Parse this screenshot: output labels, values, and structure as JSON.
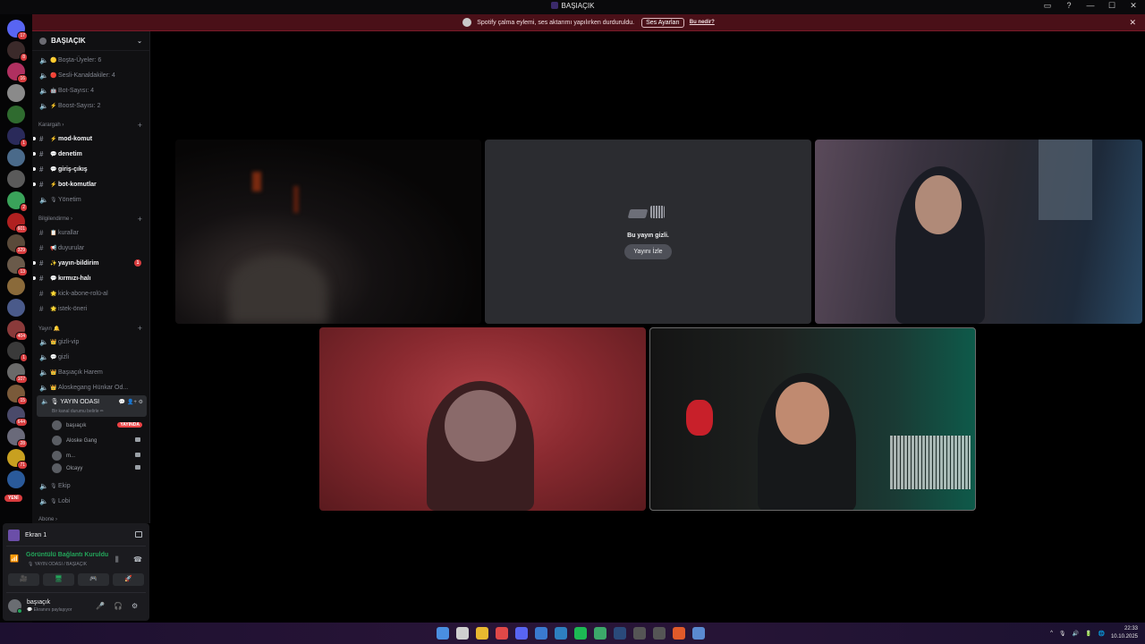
{
  "window": {
    "title": "BAŞIAÇIK",
    "controls": [
      "▭",
      "?",
      "—",
      "☐",
      "✕"
    ]
  },
  "banner": {
    "text": "Spotify çalma eylemi, ses aktarımı yapılırken durduruldu.",
    "button": "Ses Ayarları",
    "link": "Bu nedir?",
    "close": "✕"
  },
  "guilds": [
    {
      "badge": "17",
      "color": "#5865f2"
    },
    {
      "badge": "8",
      "color": "#3b2a2a"
    },
    {
      "badge": "16",
      "color": "#b03060"
    },
    {
      "badge": "",
      "color": "#8a8a8a"
    },
    {
      "badge": "",
      "color": "#2f6b2f"
    },
    {
      "badge": "1",
      "color": "#2a2a5a"
    },
    {
      "badge": "",
      "color": "#4a6a8a"
    },
    {
      "badge": "",
      "color": "#5a5a5a"
    },
    {
      "badge": "2",
      "color": "#3aa35a"
    },
    {
      "badge": "601",
      "color": "#b02020"
    },
    {
      "badge": "329",
      "color": "#5a4a3a"
    },
    {
      "badge": "13",
      "color": "#6a5a4a"
    },
    {
      "badge": "",
      "color": "#8a6a3a"
    },
    {
      "badge": "",
      "color": "#4a5a8a"
    },
    {
      "badge": "404",
      "color": "#8a3a3a"
    },
    {
      "badge": "1",
      "color": "#3a3a3a"
    },
    {
      "badge": "107",
      "color": "#6a6a6a"
    },
    {
      "badge": "15",
      "color": "#7a5a3a"
    },
    {
      "badge": "644",
      "color": "#4a4a6a"
    },
    {
      "badge": "28",
      "color": "#6a6a7a"
    },
    {
      "badge": "71",
      "color": "#c8a020"
    },
    {
      "badge": "",
      "color": "#2a5a9a"
    }
  ],
  "new_pill": "YENİ",
  "server": {
    "name": "BAŞIAÇIK",
    "stats": [
      {
        "emoji": "🟡",
        "label": "Boşta-Üyeler: 6"
      },
      {
        "emoji": "🔴",
        "label": "Sesli-Kanaldakiler: 4"
      },
      {
        "emoji": "🤖",
        "label": "Bot-Sayısı: 4"
      },
      {
        "emoji": "⚡",
        "label": "Boost-Sayısı: 2"
      }
    ],
    "categories": {
      "karargah": "Karargah",
      "bilgilendirme": "Bilgilendirme",
      "yayin": "Yayın 🔔",
      "next": "Abone"
    },
    "karargah_channels": [
      {
        "emoji": "⚡",
        "label": "mod-komut",
        "unread": true
      },
      {
        "emoji": "💬",
        "label": "denetim",
        "unread": true
      },
      {
        "emoji": "💬",
        "label": "giriş-çıkış",
        "unread": true
      },
      {
        "emoji": "⚡",
        "label": "bot-komutlar",
        "unread": true
      },
      {
        "emoji": "🎙",
        "label": "Yönetim",
        "unread": false
      }
    ],
    "bilgi_channels": [
      {
        "emoji": "📋",
        "label": "kurallar",
        "unread": false
      },
      {
        "emoji": "📢",
        "label": "duyurular",
        "unread": false
      },
      {
        "emoji": "✨",
        "label": "yayın-bildirim",
        "unread": true,
        "mention": "1"
      },
      {
        "emoji": "💬",
        "label": "kırmızı-halı",
        "unread": true
      },
      {
        "emoji": "🌟",
        "label": "kick-abone-rolü-al",
        "unread": false
      },
      {
        "emoji": "🌟",
        "label": "istek-öneri",
        "unread": false
      }
    ],
    "yayin_channels": [
      {
        "emoji": "👑",
        "label": "gizli-vip"
      },
      {
        "emoji": "💬",
        "label": "gizli"
      },
      {
        "emoji": "👑",
        "label": "Başıaçık Harem"
      },
      {
        "emoji": "👑",
        "label": "Aloskegang Hünkar Od..."
      }
    ],
    "active_channel": {
      "label": "🎙 YAYIN ODASI",
      "sub": "Bir kanal durumu belirle ✏",
      "icons": "💬 👤+ ⚙"
    },
    "voice_users": [
      {
        "name": "başıaçık",
        "live": "YAYINDA"
      },
      {
        "name": "Aloske Gang",
        "live": ""
      },
      {
        "name": "m...",
        "live": ""
      },
      {
        "name": "Olcayy",
        "live": ""
      }
    ],
    "after_channels": [
      {
        "emoji": "🎙",
        "label": "Ekip"
      },
      {
        "emoji": "🎙",
        "label": "Lobi"
      }
    ]
  },
  "panel": {
    "screen_label": "Ekran 1",
    "connection_title": "Görüntülü Bağlantı Kuruldu",
    "connection_sub": "🎙 YAYIN ODASI / BAŞIAÇIK",
    "action_icons": [
      "🎥",
      "🖥",
      "🎮",
      "🚀"
    ],
    "username": "başıaçık",
    "user_status": "💬 Ekranını paylaşıyor",
    "user_icons": [
      "🎤",
      "🎧",
      "⚙"
    ]
  },
  "hidden_stream": {
    "message": "Bu yayın gizli.",
    "watch_button": "Yayını İzle"
  },
  "taskbar": {
    "apps": [
      "#4a8fe0",
      "#cfcfcf",
      "#e8b830",
      "#e04848",
      "#5865f2",
      "#3a7ad0",
      "#2e7fc0",
      "#1db954",
      "#3ca86a",
      "#2a4a7a",
      "#555555",
      "#555555",
      "#e05a2a",
      "#5a8ad0"
    ],
    "time": "22:33",
    "date": "10.10.2025",
    "tray_icons": [
      "^",
      "🎙",
      "🔊",
      "🔋",
      "🌐"
    ]
  }
}
